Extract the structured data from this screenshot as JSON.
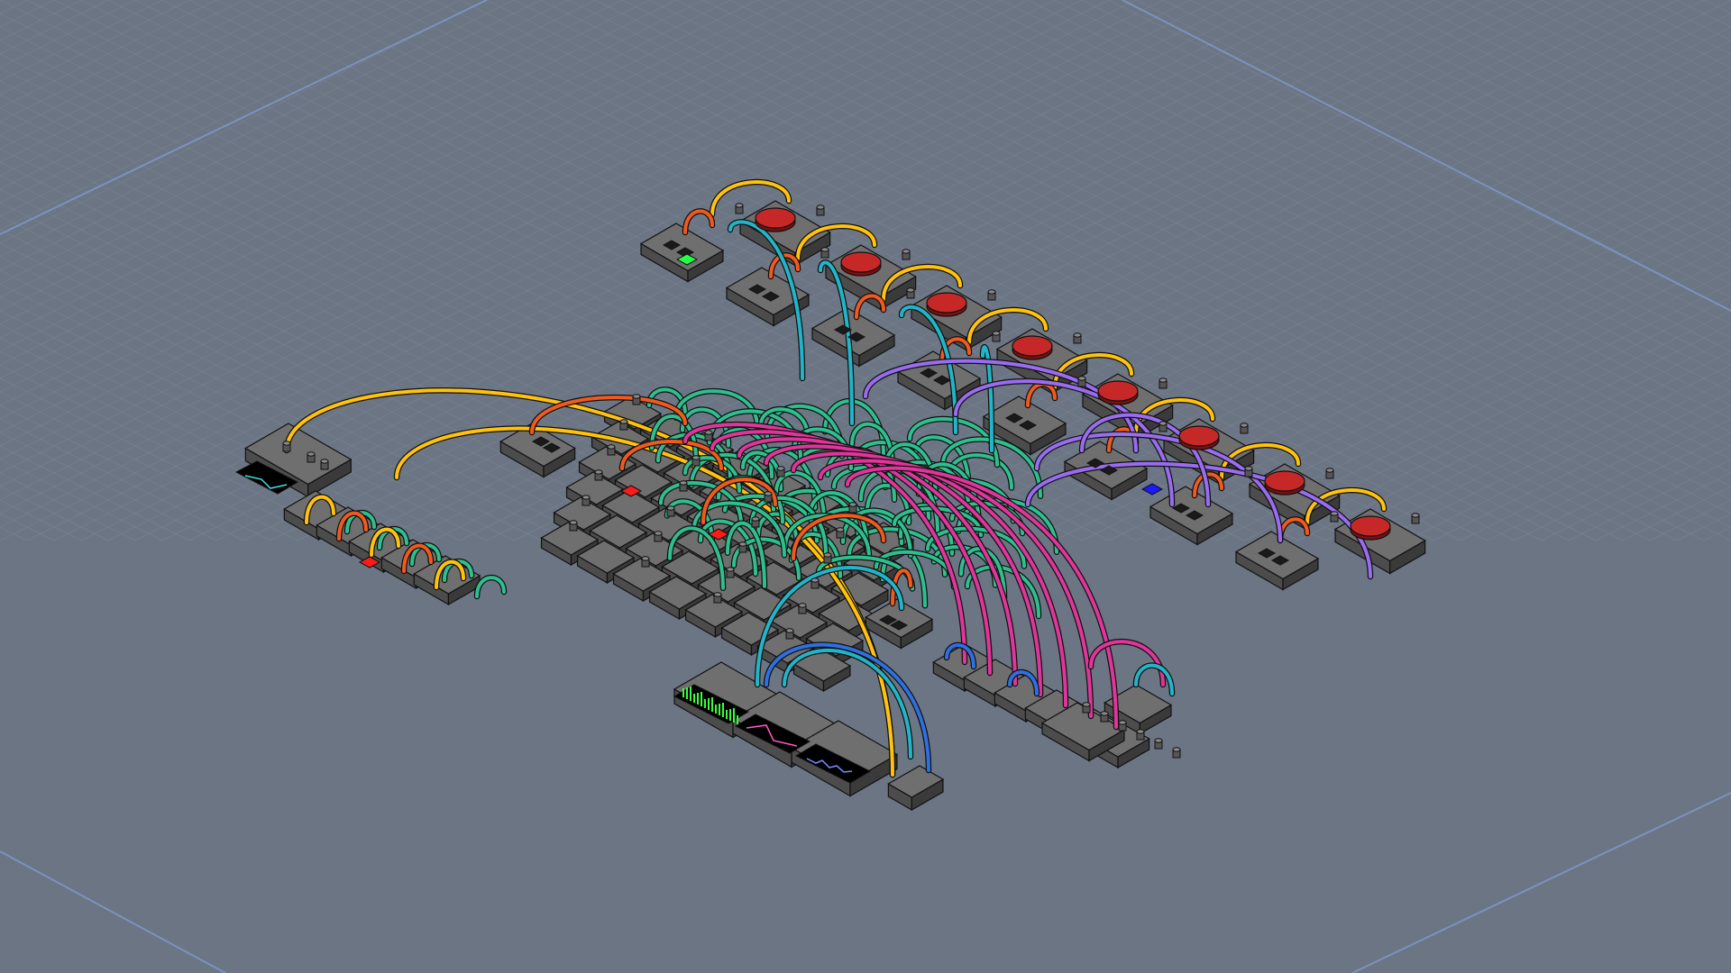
{
  "app": {
    "view": "isometric-circuit-board",
    "ui_text": []
  },
  "colors": {
    "background": "#6b7584",
    "grid_line": "#7b8594",
    "grid_major": "#7f95c6",
    "block_top": "#6f6f6f",
    "block_left": "#4c4c4c",
    "block_right": "#3a3a3a",
    "outline": "#111111",
    "button_red": "#c62828",
    "led_green": "#22ff44",
    "led_red": "#ff1a1a",
    "led_blue": "#1a1aff",
    "wire_yellow": "#ffc20e",
    "wire_orange": "#f05a1e",
    "wire_teal": "#2fbf8f",
    "wire_cyan": "#22b5c8",
    "wire_purple": "#9a6cf0",
    "wire_magenta": "#e0359a",
    "wire_blue": "#2f6fe0",
    "scope_green": "#39ff3a",
    "scope_pink": "#ff5ac8",
    "scope_blue": "#7a8cff",
    "scope_cyan": "#40e0e0"
  },
  "components": [
    {
      "kind": "push-button",
      "count": 8,
      "button_color": "red"
    },
    {
      "kind": "indicator-led",
      "colors": [
        "green",
        "red",
        "red",
        "red",
        "blue"
      ]
    },
    {
      "kind": "oscilloscope",
      "count": 4,
      "traces": [
        "cyan",
        "green",
        "pink",
        "blue"
      ]
    },
    {
      "kind": "logic-gate-cluster",
      "count": 1
    },
    {
      "kind": "knob-panel",
      "count": 1
    }
  ],
  "wire_colors": [
    "yellow",
    "orange",
    "teal",
    "cyan",
    "purple",
    "magenta",
    "blue"
  ]
}
